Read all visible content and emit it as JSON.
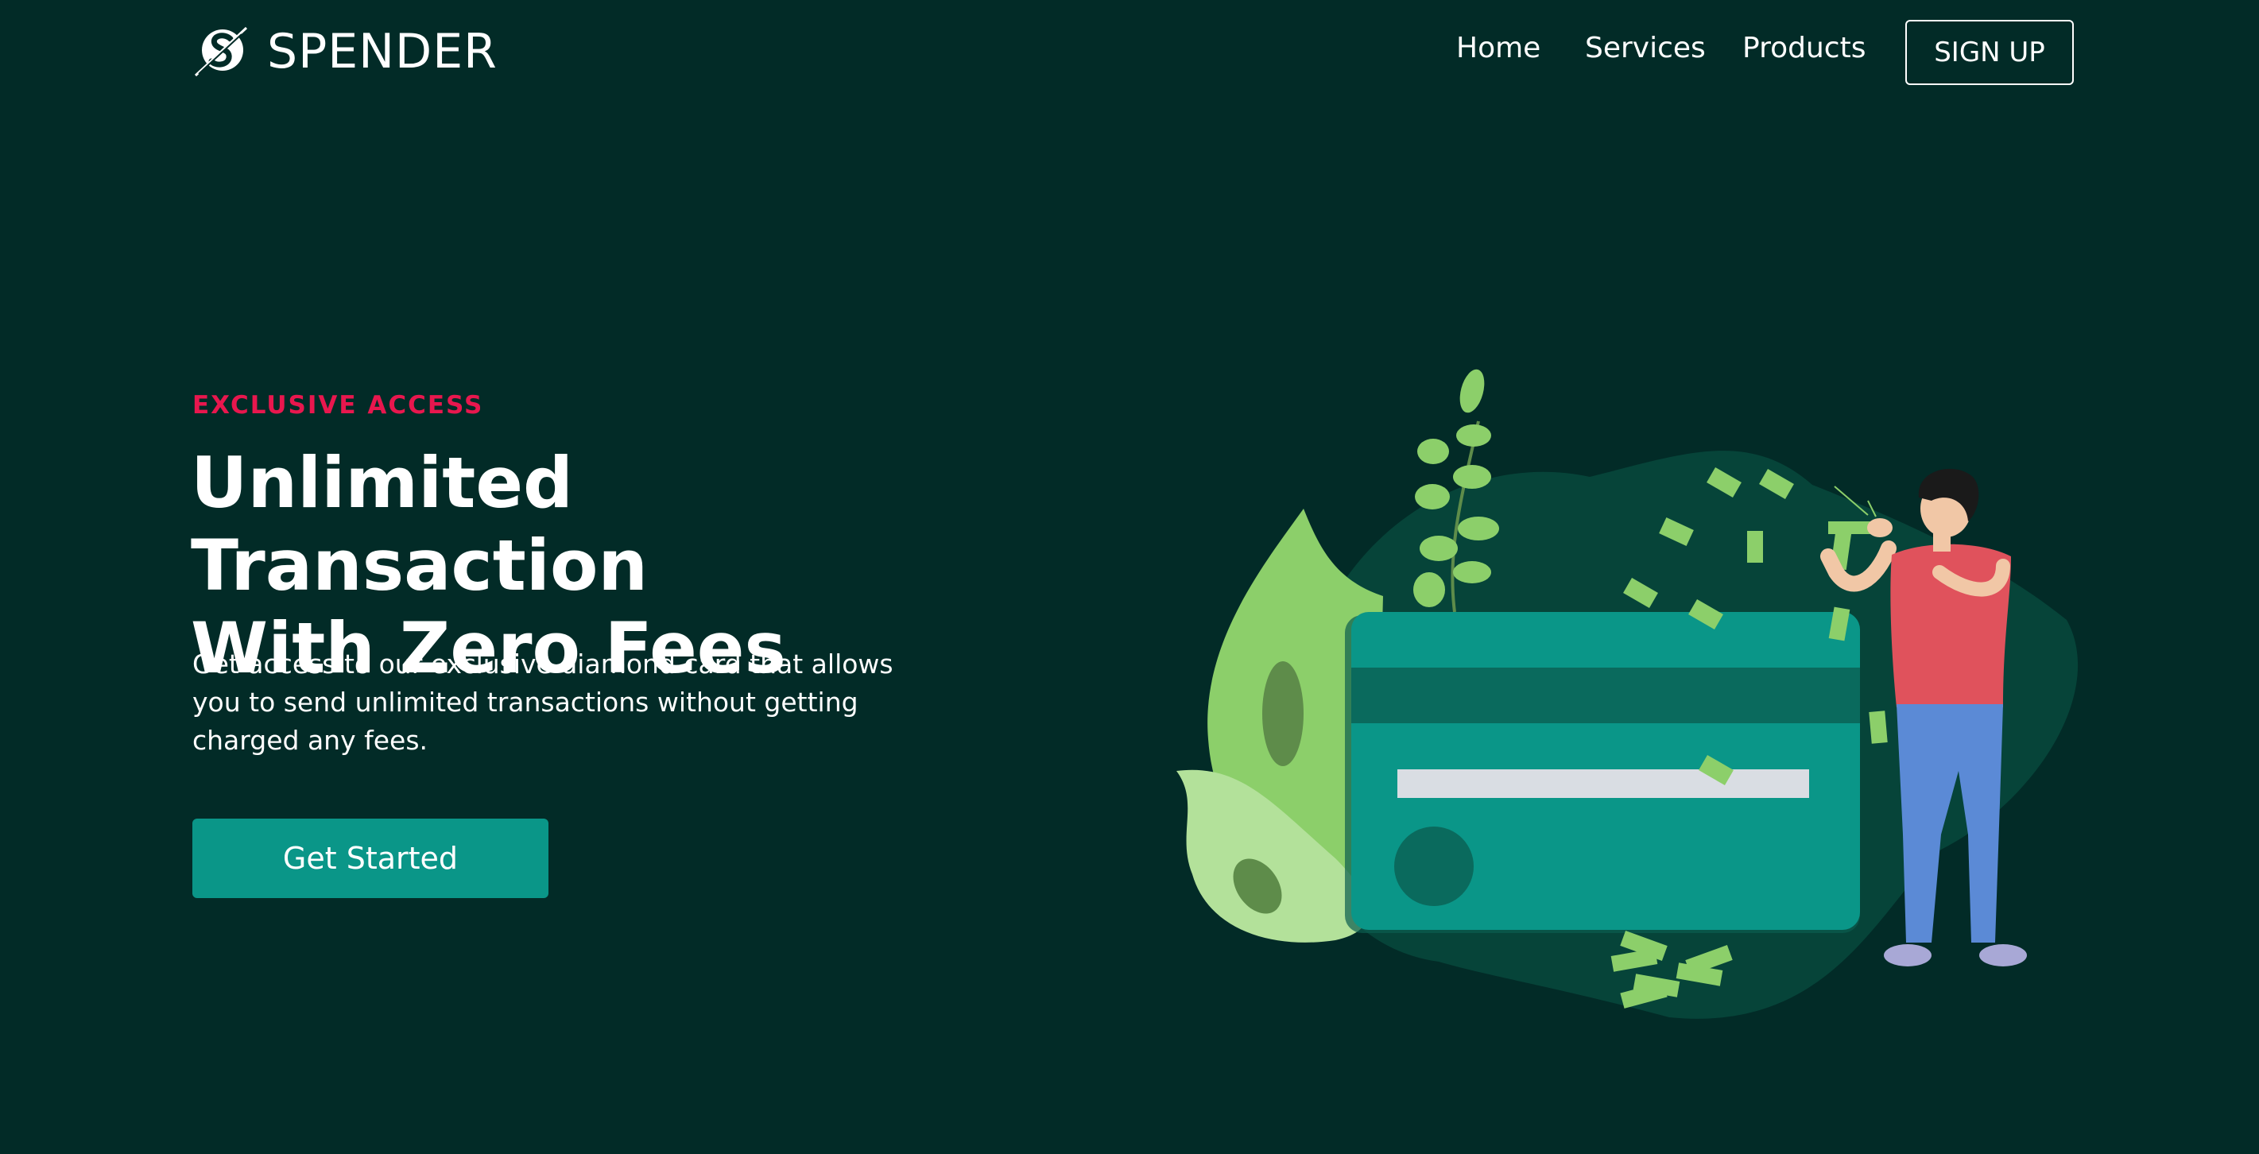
{
  "brand": {
    "name": "SPENDER",
    "logo_icon": "spender-logo-icon"
  },
  "nav": {
    "items": [
      {
        "label": "Home"
      },
      {
        "label": "Services"
      },
      {
        "label": "Products"
      }
    ],
    "signup_label": "SIGN UP"
  },
  "hero": {
    "eyebrow": "EXCLUSIVE ACCESS",
    "headline_line1": "Unlimited Transaction",
    "headline_line2": "With Zero Fees",
    "description": "Get access to our exclusive diamond card that allows you to send unlimited transactions without getting charged any fees.",
    "cta_label": "Get Started"
  },
  "colors": {
    "background": "#022b27",
    "accent": "#0a9688",
    "eyebrow": "#e8174e",
    "text": "#ffffff"
  },
  "illustration": {
    "subject": "person-with-credit-card-and-money-icon"
  }
}
